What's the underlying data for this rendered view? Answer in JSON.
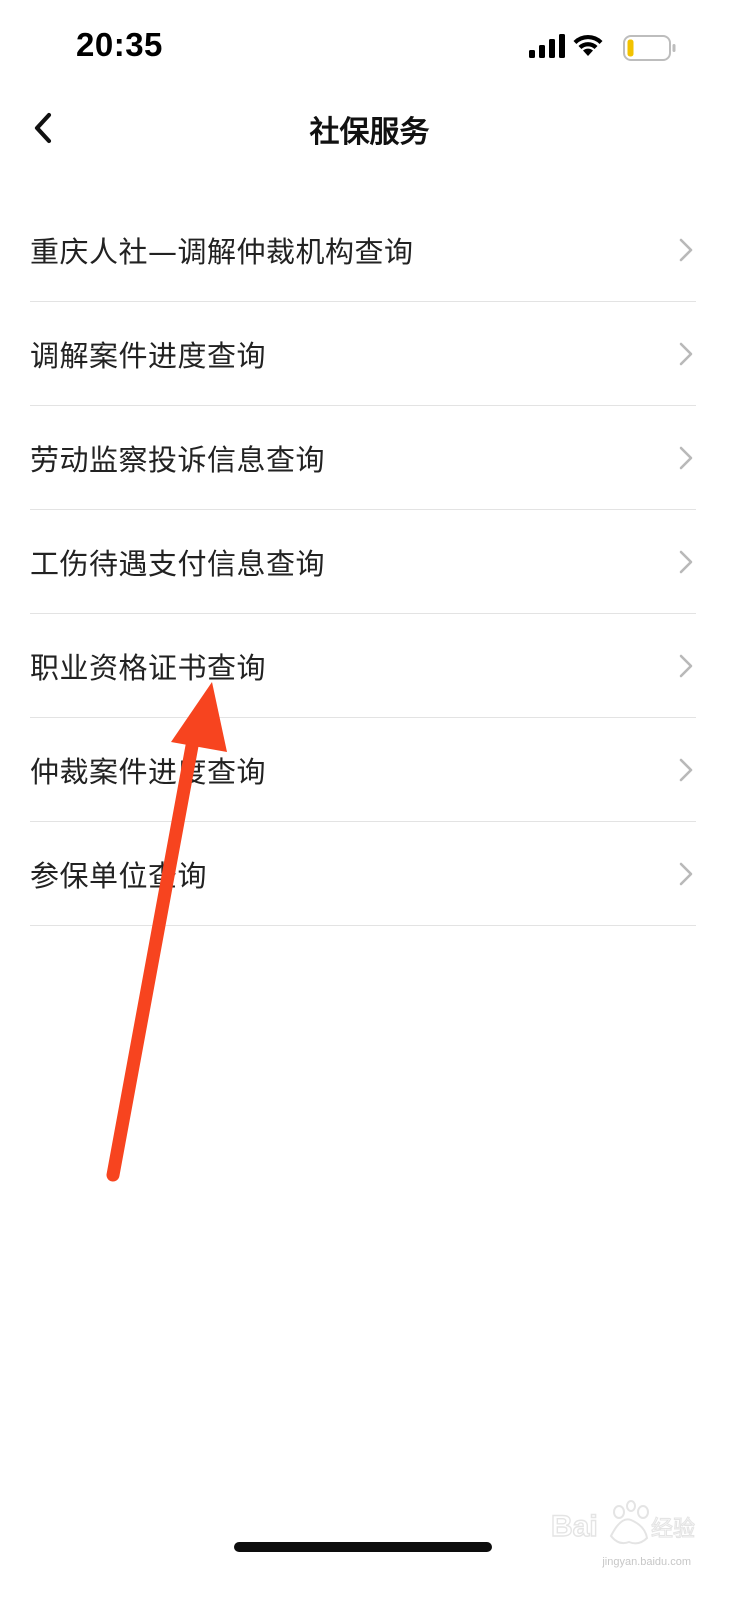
{
  "status_bar": {
    "time": "20:35",
    "icons": [
      "signal-icon",
      "wifi-icon",
      "battery-icon"
    ],
    "battery_color": "#f2c200"
  },
  "nav": {
    "title": "社保服务",
    "back_icon": "chevron-left-icon"
  },
  "menu": {
    "items": [
      {
        "label": "重庆人社—调解仲裁机构查询"
      },
      {
        "label": "调解案件进度查询"
      },
      {
        "label": "劳动监察投诉信息查询"
      },
      {
        "label": "工伤待遇支付信息查询"
      },
      {
        "label": "职业资格证书查询"
      },
      {
        "label": "仲裁案件进度查询"
      },
      {
        "label": "参保单位查询"
      }
    ]
  },
  "annotation": {
    "color": "#f7441f"
  },
  "watermark": {
    "logo_text": "Baidu经验",
    "url": "jingyan.baidu.com"
  },
  "colors": {
    "divider": "#e3e3e3",
    "chevron": "#b9b9b9",
    "text": "#222222"
  }
}
